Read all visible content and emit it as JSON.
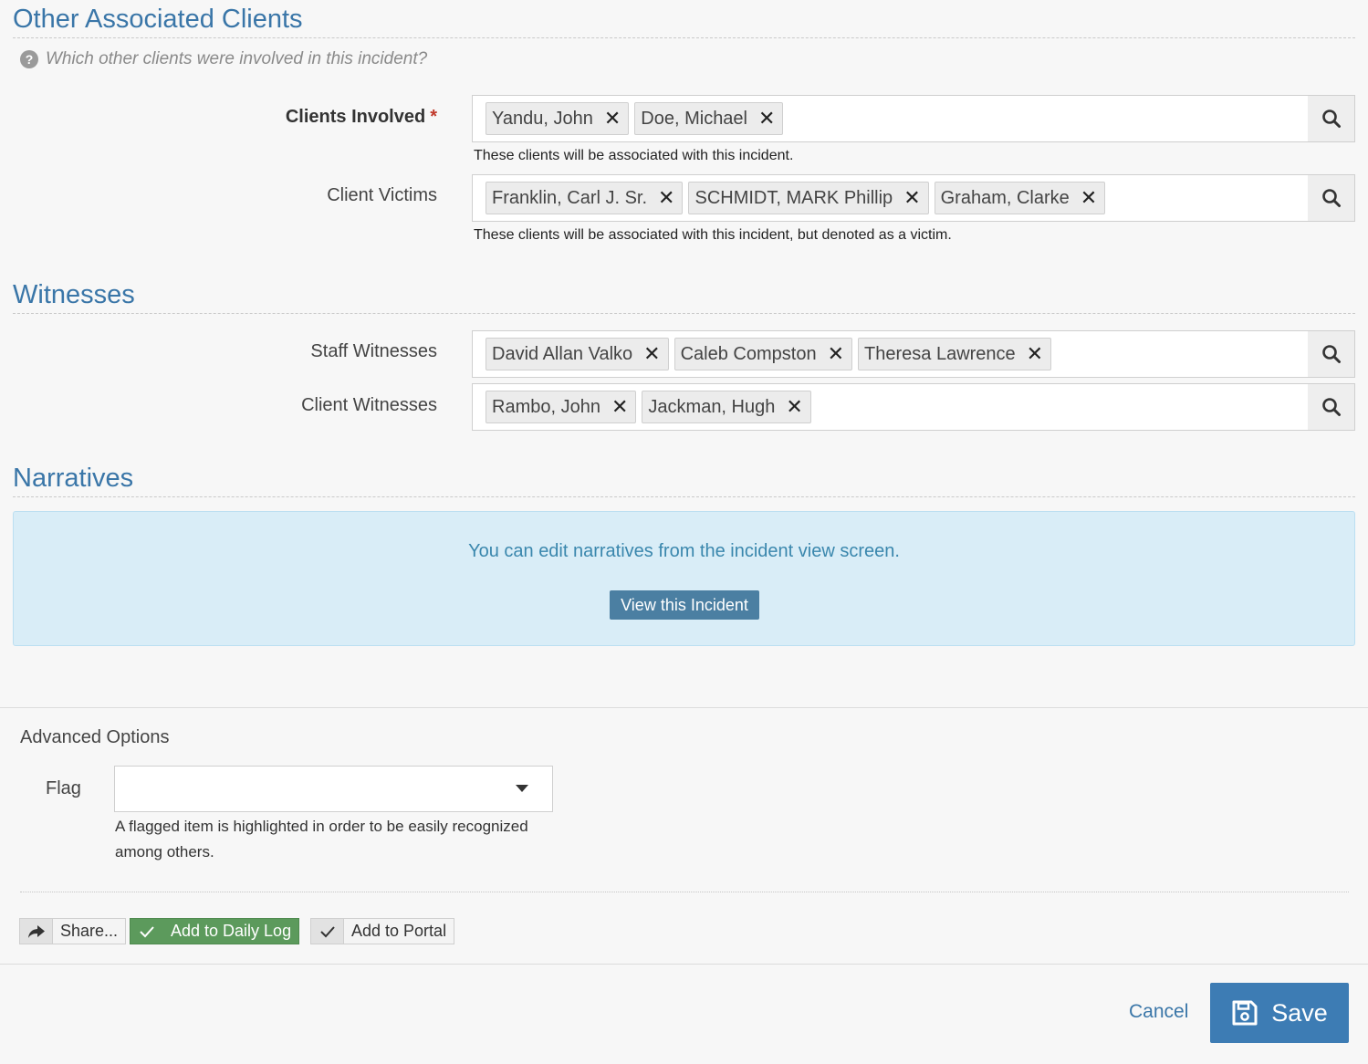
{
  "sections": {
    "associated": {
      "title": "Other Associated Clients",
      "help": "Which other clients were involved in this incident?"
    },
    "witnesses": {
      "title": "Witnesses"
    },
    "narratives": {
      "title": "Narratives"
    }
  },
  "fields": {
    "clients_involved": {
      "label": "Clients Involved",
      "required_mark": "*",
      "tags": [
        "Yandu, John",
        "Doe, Michael"
      ],
      "hint": "These clients will be associated with this incident."
    },
    "client_victims": {
      "label": "Client Victims",
      "tags": [
        "Franklin, Carl J. Sr.",
        "SCHMIDT, MARK Phillip",
        "Graham, Clarke"
      ],
      "hint": "These clients will be associated with this incident, but denoted as a victim."
    },
    "staff_witnesses": {
      "label": "Staff Witnesses",
      "tags": [
        "David Allan Valko",
        "Caleb Compston",
        "Theresa Lawrence"
      ]
    },
    "client_witnesses": {
      "label": "Client Witnesses",
      "tags": [
        "Rambo, John",
        "Jackman, Hugh"
      ]
    }
  },
  "tag_remove_glyph": "✕",
  "narratives_alert": {
    "text": "You can edit narratives from the incident view screen.",
    "button": "View this Incident"
  },
  "advanced": {
    "title": "Advanced Options",
    "flag_label": "Flag",
    "flag_value": "",
    "flag_hint": "A flagged item is highlighted in order to be easily recognized among others."
  },
  "options": {
    "share": "Share...",
    "daily_log": "Add to Daily Log",
    "portal": "Add to Portal"
  },
  "footer": {
    "cancel": "Cancel",
    "save": "Save"
  },
  "colors": {
    "accent": "#3a76a8",
    "alert_bg": "#d9edf7",
    "green": "#5c9a5c",
    "save_bg": "#3d7cb4"
  }
}
